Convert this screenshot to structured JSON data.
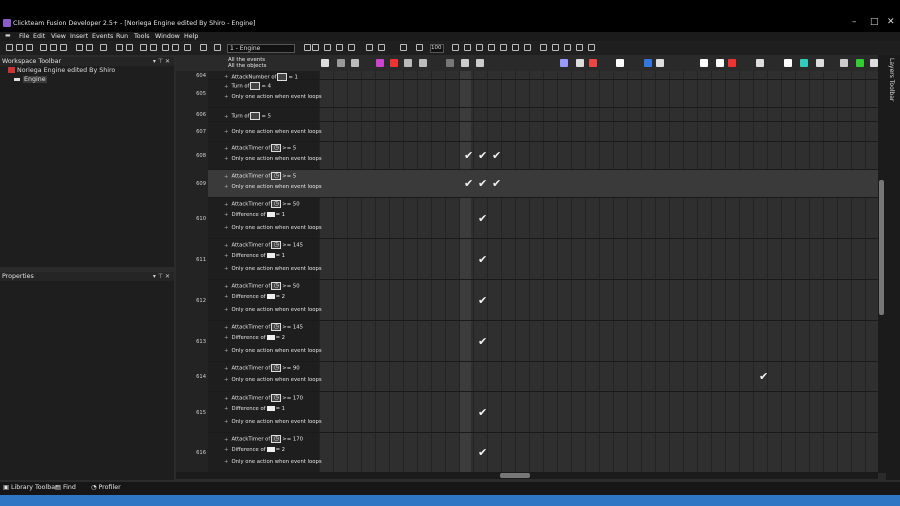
{
  "window": {
    "title": "Clickteam Fusion Developer 2.5+ - [Noriega Engine edited By Shiro - Engine]"
  },
  "menu": [
    "File",
    "Edit",
    "View",
    "Insert",
    "Events",
    "Run",
    "Tools",
    "Window",
    "Help"
  ],
  "toolbar": {
    "frame_select": "1 - Engine",
    "zoom": "100"
  },
  "workspace": {
    "header": "Workspace Toolbar",
    "app_name": "Noriega Engine edited By Shiro",
    "frame": "Engine"
  },
  "properties": {
    "header": "Properties"
  },
  "editor": {
    "all_events": "All the events",
    "all_objects": "All the objects"
  },
  "events": [
    {
      "num": "604",
      "lines": [
        {
          "a": "AttackNumber of",
          "b": "= 1",
          "icon": "box"
        }
      ]
    },
    {
      "num": "605",
      "lines": [
        {
          "a": "Turn of",
          "b": "= 4",
          "icon": "box"
        },
        {
          "a": "Only one action when event loops"
        }
      ]
    },
    {
      "num": "606",
      "lines": [
        {
          "a": "Turn of",
          "b": "= 5",
          "icon": "box"
        }
      ]
    },
    {
      "num": "607",
      "lines": [
        {
          "a": "Only one action when event loops"
        }
      ]
    },
    {
      "num": "608",
      "lines": [
        {
          "a": "AttackTimer of",
          "b": ">= 5",
          "icon": "clock"
        },
        {
          "a": "Only one action when event loops"
        }
      ]
    },
    {
      "num": "609",
      "lines": [
        {
          "a": "AttackTimer of",
          "b": ">= 5",
          "icon": "clock"
        },
        {
          "a": "Only one action when event loops"
        }
      ]
    },
    {
      "num": "610",
      "lines": [
        {
          "a": "AttackTimer of",
          "b": ">= 50",
          "icon": "clock"
        },
        {
          "a": "Difference of",
          "b": "= 1",
          "icon": "mini"
        },
        {
          "a": "Only one action when event loops"
        }
      ]
    },
    {
      "num": "611",
      "lines": [
        {
          "a": "AttackTimer of",
          "b": ">= 145",
          "icon": "clock"
        },
        {
          "a": "Difference of",
          "b": "= 1",
          "icon": "mini"
        },
        {
          "a": "Only one action when event loops"
        }
      ]
    },
    {
      "num": "612",
      "lines": [
        {
          "a": "AttackTimer of",
          "b": ">= 50",
          "icon": "clock"
        },
        {
          "a": "Difference of",
          "b": "= 2",
          "icon": "mini"
        },
        {
          "a": "Only one action when event loops"
        }
      ]
    },
    {
      "num": "613",
      "lines": [
        {
          "a": "AttackTimer of",
          "b": ">= 145",
          "icon": "clock"
        },
        {
          "a": "Difference of",
          "b": "= 2",
          "icon": "mini"
        },
        {
          "a": "Only one action when event loops"
        }
      ]
    },
    {
      "num": "614",
      "lines": [
        {
          "a": "AttackTimer of",
          "b": ">= 90",
          "icon": "clock"
        },
        {
          "a": "Only one action when event loops"
        }
      ]
    },
    {
      "num": "615",
      "lines": [
        {
          "a": "AttackTimer of",
          "b": ">= 170",
          "icon": "clock"
        },
        {
          "a": "Difference of",
          "b": "= 1",
          "icon": "mini"
        },
        {
          "a": "Only one action when event loops"
        }
      ]
    },
    {
      "num": "616",
      "lines": [
        {
          "a": "AttackTimer of",
          "b": ">= 170",
          "icon": "clock"
        },
        {
          "a": "Difference of",
          "b": "= 2",
          "icon": "mini"
        },
        {
          "a": "Only one action when event loops"
        }
      ]
    }
  ],
  "bottom_tabs": [
    "Library Toolbar",
    "Find",
    "Profiler"
  ],
  "layers_toolbar": "Layers Toolbar",
  "icons": [
    "app-icon",
    "minimize-icon",
    "maximize-icon",
    "close-icon",
    "checkmark-icon",
    "clock-icon"
  ]
}
